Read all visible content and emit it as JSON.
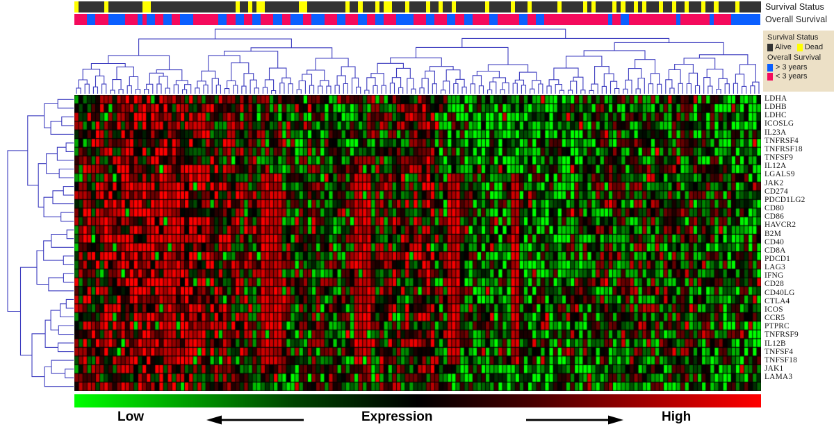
{
  "figure": {
    "type": "clustered-heatmap",
    "title": "",
    "annotation_tracks": [
      {
        "name": "Survival Status",
        "label": "Survival Status"
      },
      {
        "name": "Overall Survival",
        "label": "Overall Survival"
      }
    ]
  },
  "legend": {
    "survival_status": {
      "title": "Survival Status",
      "items": [
        {
          "label": "Alive",
          "color": "#333333"
        },
        {
          "label": "Dead",
          "color": "#ffff00"
        }
      ]
    },
    "overall_survival": {
      "title": "Overall Survival",
      "items": [
        {
          "label": "> 3 years",
          "color": "#0b5fff"
        },
        {
          "label": "< 3 years",
          "color": "#f40a5c"
        }
      ]
    },
    "background_color": "#ece0c6"
  },
  "colorbar": {
    "low_label": "Low",
    "center_label": "Expression",
    "high_label": "High",
    "low_color": "#00ff00",
    "mid_color": "#000000",
    "high_color": "#ff0000",
    "left_arrow": "left-arrow",
    "right_arrow": "right-arrow"
  },
  "genes": [
    "LDHA",
    "LDHB",
    "LDHC",
    "ICOSLG",
    "IL23A",
    "TNFRSF4",
    "TNFRSF18",
    "TNFSF9",
    "IL12A",
    "LGALS9",
    "JAK2",
    "CD274",
    "PDCD1LG2",
    "CD80",
    "CD86",
    "HAVCR2",
    "B2M",
    "CD40",
    "CD8A",
    "PDCD1",
    "LAG3",
    "IFNG",
    "CD28",
    "CD40LG",
    "CTLA4",
    "ICOS",
    "CCR5",
    "PTPRC",
    "TNFRSF9",
    "IL12B",
    "TNFSF4",
    "TNFSF18",
    "JAK1",
    "LAMA3"
  ],
  "chart_data": {
    "type": "heatmap",
    "title": "",
    "xlabel": "",
    "ylabel": "",
    "rows": [
      "LDHA",
      "LDHB",
      "LDHC",
      "ICOSLG",
      "IL23A",
      "TNFRSF4",
      "TNFRSF18",
      "TNFSF9",
      "IL12A",
      "LGALS9",
      "JAK2",
      "CD274",
      "PDCD1LG2",
      "CD80",
      "CD86",
      "HAVCR2",
      "B2M",
      "CD40",
      "CD8A",
      "PDCD1",
      "LAG3",
      "IFNG",
      "CD28",
      "CD40LG",
      "CTLA4",
      "ICOS",
      "CCR5",
      "PTPRC",
      "TNFRSF9",
      "IL12B",
      "TNFSF4",
      "TNFSF18",
      "JAK1",
      "LAMA3"
    ],
    "n_columns": 162,
    "n_rows": 34,
    "colormap": "green-black-red",
    "value_range": [
      -3,
      3
    ],
    "colorbar_labels": [
      "Low",
      "Expression",
      "High"
    ],
    "column_annotations": {
      "Survival Status": {
        "categories": [
          "Alive",
          "Dead"
        ],
        "colors": [
          "#333333",
          "#ffff00"
        ],
        "values": [
          "Dead",
          "Alive",
          "Alive",
          "Alive",
          "Alive",
          "Alive",
          "Alive",
          "Dead",
          "Alive",
          "Alive",
          "Alive",
          "Alive",
          "Alive",
          "Alive",
          "Alive",
          "Alive",
          "Dead",
          "Dead",
          "Alive",
          "Alive",
          "Alive",
          "Alive",
          "Alive",
          "Alive",
          "Alive",
          "Alive",
          "Alive",
          "Alive",
          "Alive",
          "Alive",
          "Alive",
          "Alive",
          "Alive",
          "Alive",
          "Alive",
          "Alive",
          "Alive",
          "Alive",
          "Dead",
          "Alive",
          "Alive",
          "Dead",
          "Alive",
          "Dead",
          "Dead",
          "Alive",
          "Alive",
          "Alive",
          "Alive",
          "Alive",
          "Alive",
          "Alive",
          "Alive",
          "Dead",
          "Dead",
          "Alive",
          "Alive",
          "Alive",
          "Alive",
          "Alive",
          "Alive",
          "Alive",
          "Alive",
          "Alive",
          "Dead",
          "Alive",
          "Alive",
          "Dead",
          "Alive",
          "Alive",
          "Alive",
          "Dead",
          "Alive",
          "Dead",
          "Dead",
          "Alive",
          "Alive",
          "Alive",
          "Dead",
          "Alive",
          "Alive",
          "Alive",
          "Alive",
          "Dead",
          "Alive",
          "Alive",
          "Dead",
          "Alive",
          "Alive",
          "Dead",
          "Alive",
          "Alive",
          "Alive",
          "Alive",
          "Alive",
          "Alive",
          "Alive",
          "Dead",
          "Alive",
          "Alive",
          "Alive",
          "Alive",
          "Alive",
          "Dead",
          "Alive",
          "Alive",
          "Alive",
          "Dead",
          "Alive",
          "Alive",
          "Alive",
          "Alive",
          "Alive",
          "Alive",
          "Dead",
          "Alive",
          "Alive",
          "Alive",
          "Alive",
          "Alive",
          "Dead",
          "Alive",
          "Dead",
          "Alive",
          "Alive",
          "Alive",
          "Alive",
          "Dead",
          "Alive",
          "Dead",
          "Alive",
          "Alive",
          "Dead",
          "Alive",
          "Dead",
          "Alive",
          "Alive",
          "Alive",
          "Dead",
          "Alive",
          "Alive",
          "Dead",
          "Alive",
          "Alive",
          "Dead",
          "Alive",
          "Alive",
          "Alive",
          "Dead",
          "Alive",
          "Alive",
          "Dead",
          "Alive",
          "Alive",
          "Alive",
          "Alive",
          "Dead",
          "Alive",
          "Alive",
          "Alive",
          "Alive",
          "Alive"
        ]
      },
      "Overall Survival": {
        "categories": [
          "> 3 years",
          "< 3 years"
        ],
        "colors": [
          "#0b5fff",
          "#f40a5c"
        ],
        "values": [
          "< 3 years",
          "< 3 years",
          "< 3 years",
          "> 3 years",
          "> 3 years",
          "< 3 years",
          "< 3 years",
          "< 3 years",
          "> 3 years",
          "> 3 years",
          "> 3 years",
          "> 3 years",
          "< 3 years",
          "< 3 years",
          "< 3 years",
          "> 3 years",
          "< 3 years",
          "> 3 years",
          "> 3 years",
          "< 3 years",
          "< 3 years",
          "> 3 years",
          "> 3 years",
          "< 3 years",
          "< 3 years",
          "> 3 years",
          "> 3 years",
          "> 3 years",
          "< 3 years",
          "< 3 years",
          "< 3 years",
          "< 3 years",
          "< 3 years",
          "< 3 years",
          "> 3 years",
          "> 3 years",
          "< 3 years",
          "< 3 years",
          "> 3 years",
          "> 3 years",
          "< 3 years",
          "< 3 years",
          "> 3 years",
          "> 3 years",
          "< 3 years",
          "< 3 years",
          "< 3 years",
          "> 3 years",
          "> 3 years",
          "< 3 years",
          "< 3 years",
          "> 3 years",
          "> 3 years",
          "> 3 years",
          "< 3 years",
          "< 3 years",
          "> 3 years",
          "> 3 years",
          "> 3 years",
          "< 3 years",
          "< 3 years",
          "< 3 years",
          "> 3 years",
          "> 3 years",
          "< 3 years",
          "< 3 years",
          "< 3 years",
          "> 3 years",
          "> 3 years",
          "< 3 years",
          "< 3 years",
          "> 3 years",
          "> 3 years",
          "< 3 years",
          "< 3 years",
          "< 3 years",
          "> 3 years",
          "> 3 years",
          "> 3 years",
          "> 3 years",
          "< 3 years",
          "< 3 years",
          "< 3 years",
          "> 3 years",
          "> 3 years",
          "< 3 years",
          "< 3 years",
          "< 3 years",
          "> 3 years",
          "> 3 years",
          "< 3 years",
          "< 3 years",
          "> 3 years",
          "> 3 years",
          "< 3 years",
          "< 3 years",
          "< 3 years",
          "< 3 years",
          "> 3 years",
          "> 3 years",
          "< 3 years",
          "< 3 years",
          "< 3 years",
          "< 3 years",
          "< 3 years",
          "> 3 years",
          "> 3 years",
          "< 3 years",
          "< 3 years",
          "> 3 years",
          "> 3 years",
          "< 3 years",
          "< 3 years",
          "< 3 years",
          "< 3 years",
          "< 3 years",
          "< 3 years",
          "< 3 years",
          "< 3 years",
          "< 3 years",
          "< 3 years",
          "< 3 years",
          "< 3 years",
          "< 3 years",
          "< 3 years",
          "< 3 years",
          "> 3 years",
          "< 3 years",
          "< 3 years",
          "> 3 years",
          "> 3 years",
          "< 3 years",
          "< 3 years",
          "< 3 years",
          "< 3 years",
          "< 3 years",
          "< 3 years",
          "< 3 years",
          "< 3 years",
          "< 3 years",
          "< 3 years",
          "< 3 years",
          "> 3 years",
          "< 3 years",
          "< 3 years",
          "< 3 years",
          "< 3 years",
          "< 3 years",
          "< 3 years",
          "< 3 years",
          "> 3 years",
          "< 3 years",
          "< 3 years",
          "< 3 years",
          "< 3 years",
          "> 3 years",
          "> 3 years",
          "> 3 years",
          "> 3 years",
          "> 3 years",
          "> 3 years",
          "> 3 years"
        ]
      }
    },
    "row_dendrogram": true,
    "column_dendrogram": true,
    "dendrogram_color": "#3b3bbf"
  }
}
